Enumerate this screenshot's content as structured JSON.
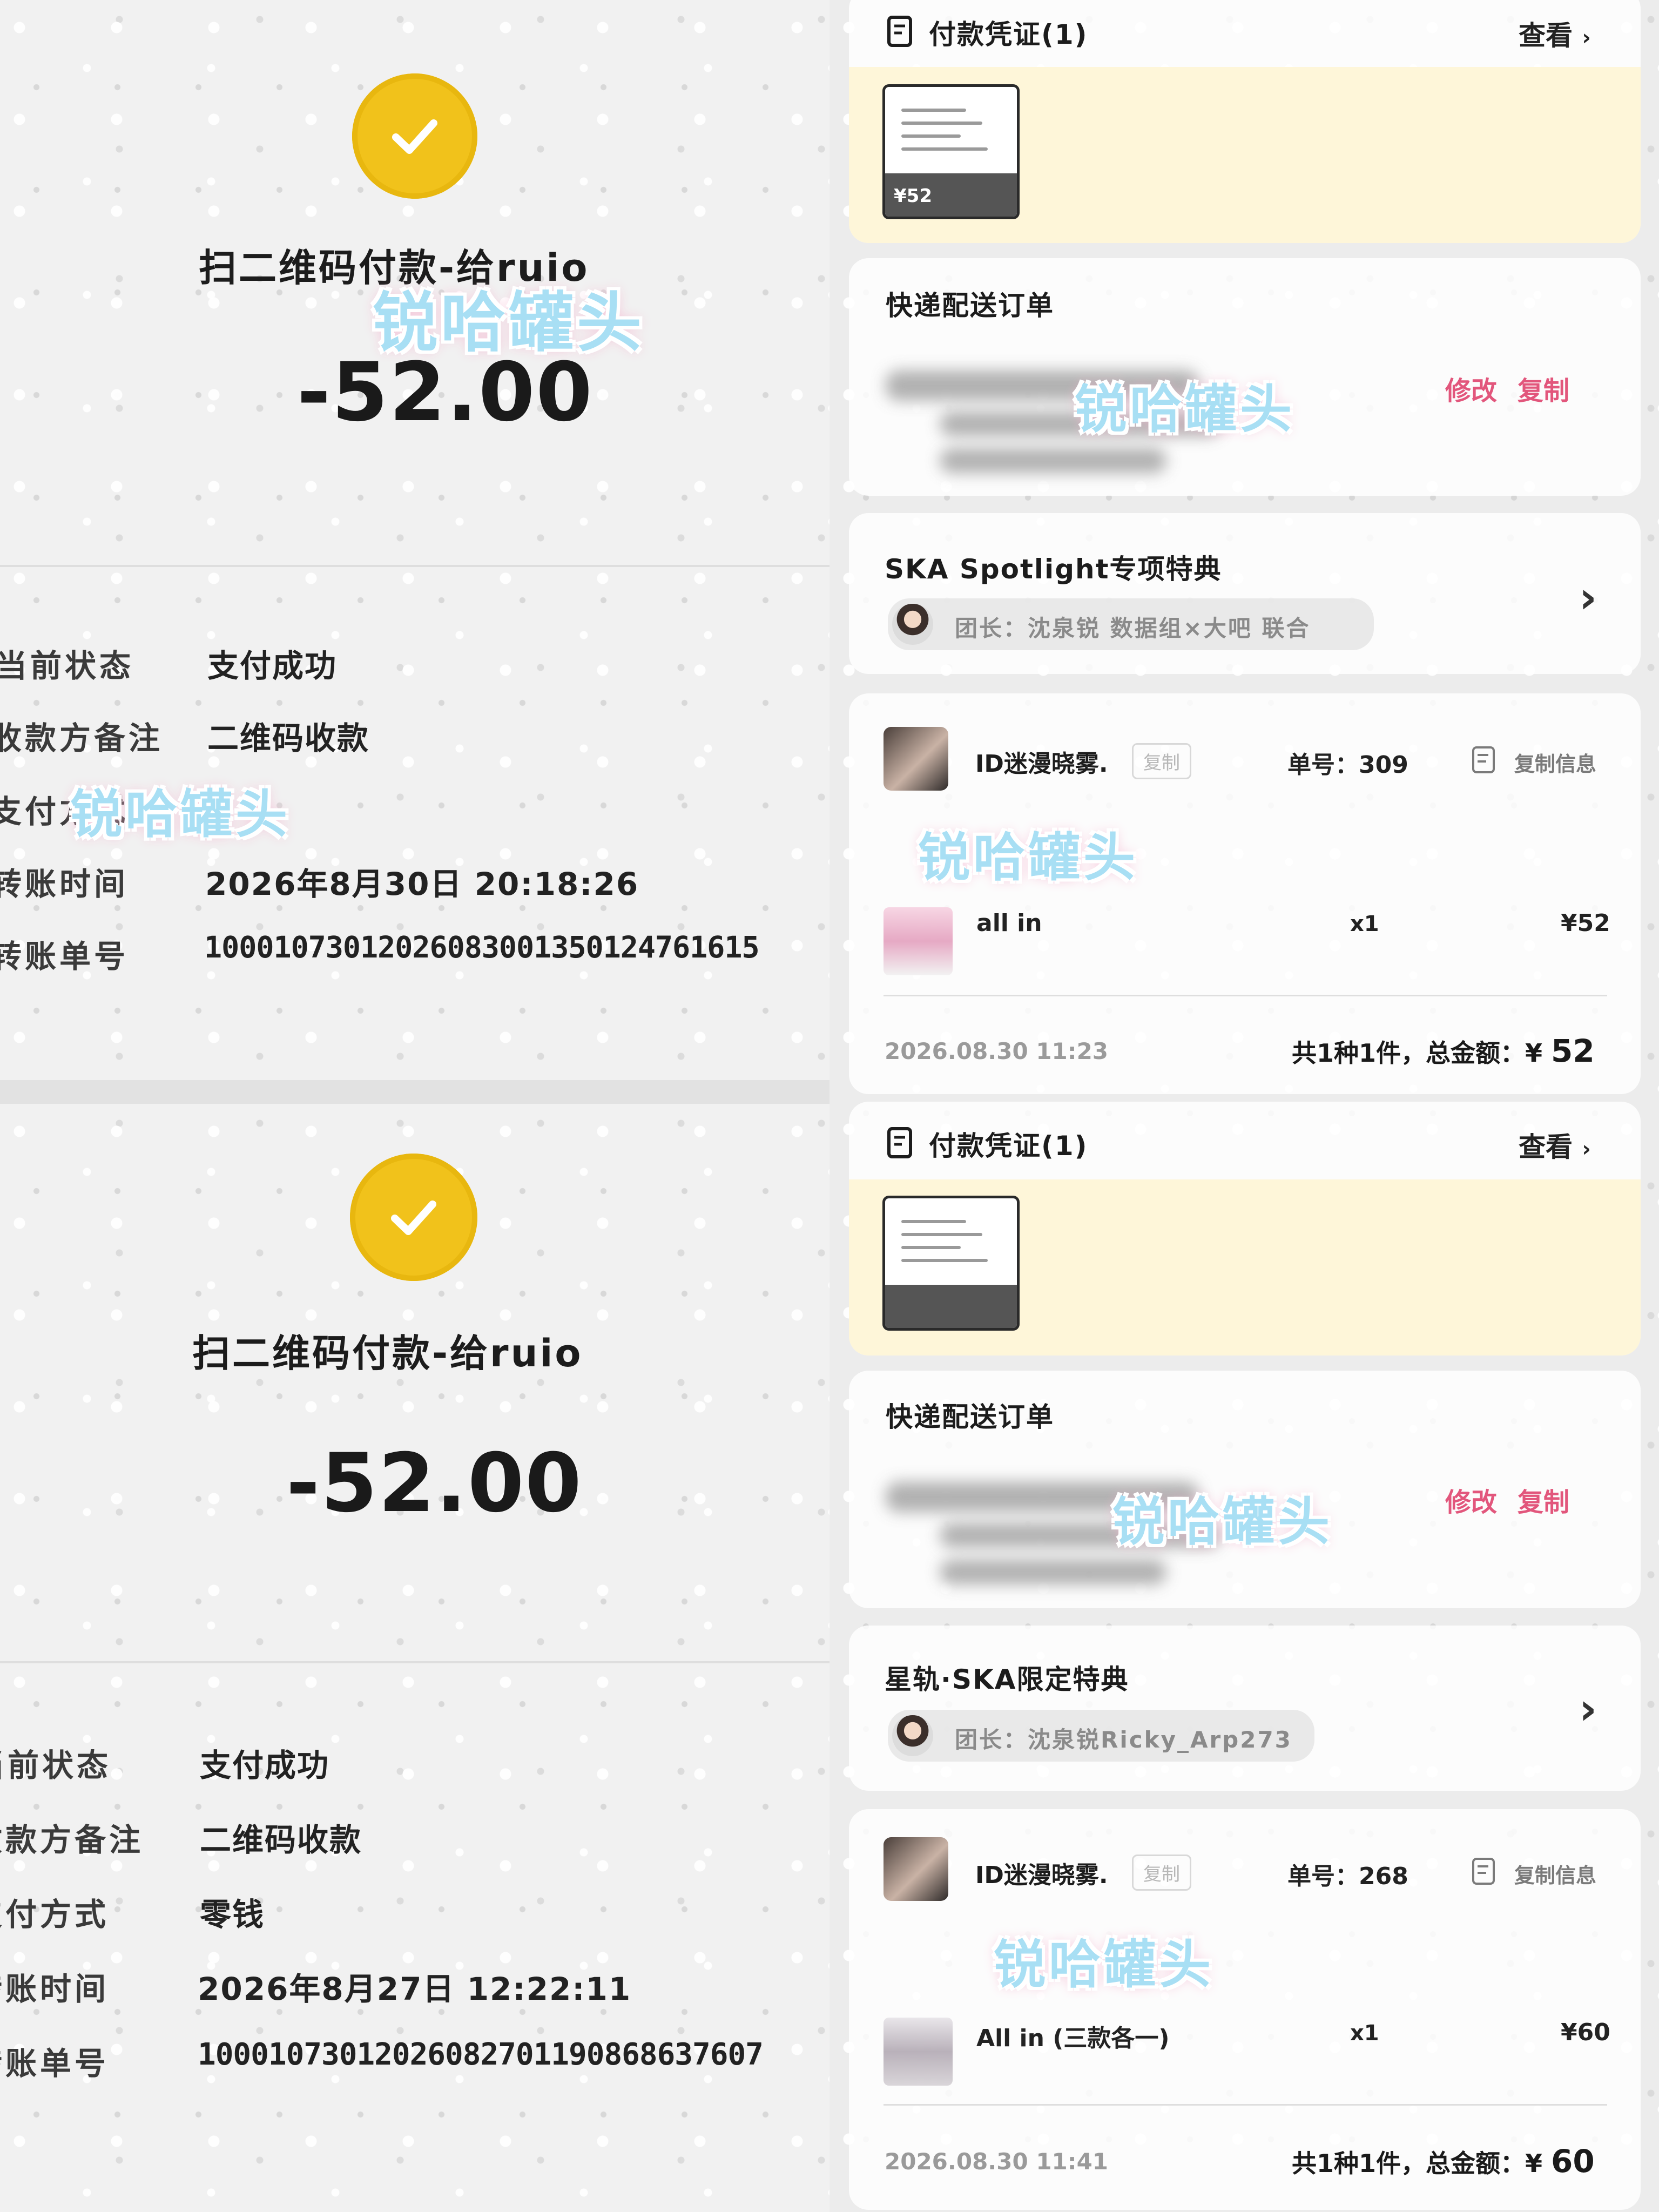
{
  "receipt_1": {
    "title": "扫二维码付款-给ruio",
    "amount": "-52.00",
    "rows": [
      {
        "label": "当前状态",
        "value": "支付成功"
      },
      {
        "label": "收款方备注",
        "value": "二维码收款"
      },
      {
        "label": "支付方式",
        "value": ""
      },
      {
        "label": "转账时间",
        "value": "2026年8月30日  20:18:26"
      },
      {
        "label": "转账单号",
        "value": "100010730120260830013501247616​15"
      }
    ]
  },
  "receipt_2": {
    "title": "扫二维码付款-给ruio",
    "amount": "-52.00",
    "rows": [
      {
        "label": "当前状态",
        "value": "支付成功"
      },
      {
        "label": "收款方备注",
        "value": "二维码收款"
      },
      {
        "label": "支付方式",
        "value": "零钱"
      },
      {
        "label": "转账时间",
        "value": "2026年8月27日  12:22:11"
      },
      {
        "label": "转账单号",
        "value": "100010730120260827011908686376​07"
      }
    ]
  },
  "order_1": {
    "voucher_title": "付款凭证(1)",
    "view_label": "查看",
    "thumb_price": "¥52",
    "delivery_title": "快递配送订单",
    "edit_label": "修改",
    "copy_label": "复制",
    "campaign_title": "SKA Spotlight专项特典",
    "leader": "团长：沈泉锐 数据组×大吧 联合",
    "user": "ID迷漫晓雾.",
    "copy_chip": "复制",
    "order_no": "单号：309",
    "copy_info": "复制信息",
    "product": "all in",
    "qty": "x1",
    "price": "¥52",
    "date": "2026.08.30 11:23",
    "total_prefix": "共1种1件，总金额：¥",
    "total_value": "52"
  },
  "order_2": {
    "voucher_title": "付款凭证(1)",
    "view_label": "查看",
    "delivery_title": "快递配送订单",
    "edit_label": "修改",
    "copy_label": "复制",
    "campaign_title": "星轨·SKA限定特典",
    "leader": "团长：沈泉锐Ricky_Arp273",
    "user": "ID迷漫晓雾.",
    "copy_chip": "复制",
    "order_no": "单号：268",
    "copy_info": "复制信息",
    "product": "All in (三款各一)",
    "qty": "x1",
    "price": "¥60",
    "date": "2026.08.30 11:41",
    "total_prefix": "共1种1件，总金额：¥",
    "total_value": "60"
  },
  "watermark": "锐哈罐头",
  "colors": {
    "coin": "#f1c21b",
    "pink_action": "#e2567c",
    "voucher_bg": "#fef5d6"
  },
  "icons": [
    "coin-bag-check-icon",
    "receipt-icon",
    "chevron-right-icon",
    "copy-doc-icon"
  ]
}
